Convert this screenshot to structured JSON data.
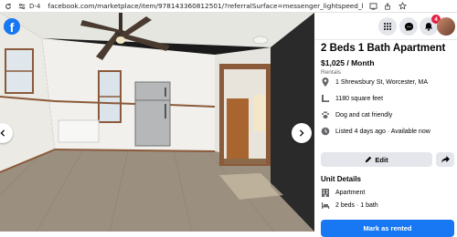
{
  "browser": {
    "tab_id": "D-4",
    "url": "facebook.com/marketplace/item/978143360812501/?referralSurface=messenger_lightspeed_banner&referralCode=messeng..."
  },
  "viewer": {
    "brand": "f"
  },
  "topbar": {
    "notification_count": "4"
  },
  "listing": {
    "title": "2 Beds 1 Bath Apartment",
    "price": "$1,025 / Month",
    "category": "Rentals",
    "details": [
      {
        "icon": "location-icon",
        "text": "1 Shrewsbury St, Worcester, MA"
      },
      {
        "icon": "ruler-icon",
        "text": "1180 square feet"
      },
      {
        "icon": "paw-icon",
        "text": "Dog and cat friendly"
      },
      {
        "icon": "clock-icon",
        "text": "Listed 4 days ago · Available now"
      }
    ],
    "edit_label": "Edit",
    "unit_details_title": "Unit Details",
    "unit_details": [
      {
        "icon": "building-icon",
        "text": "Apartment"
      },
      {
        "icon": "bed-icon",
        "text": "2 beds · 1 bath"
      }
    ],
    "mark_as_rented_label": "Mark as rented"
  },
  "colors": {
    "brand_blue": "#1877f2",
    "button_grey": "#e4e6eb",
    "badge_red": "#e41e3f"
  }
}
